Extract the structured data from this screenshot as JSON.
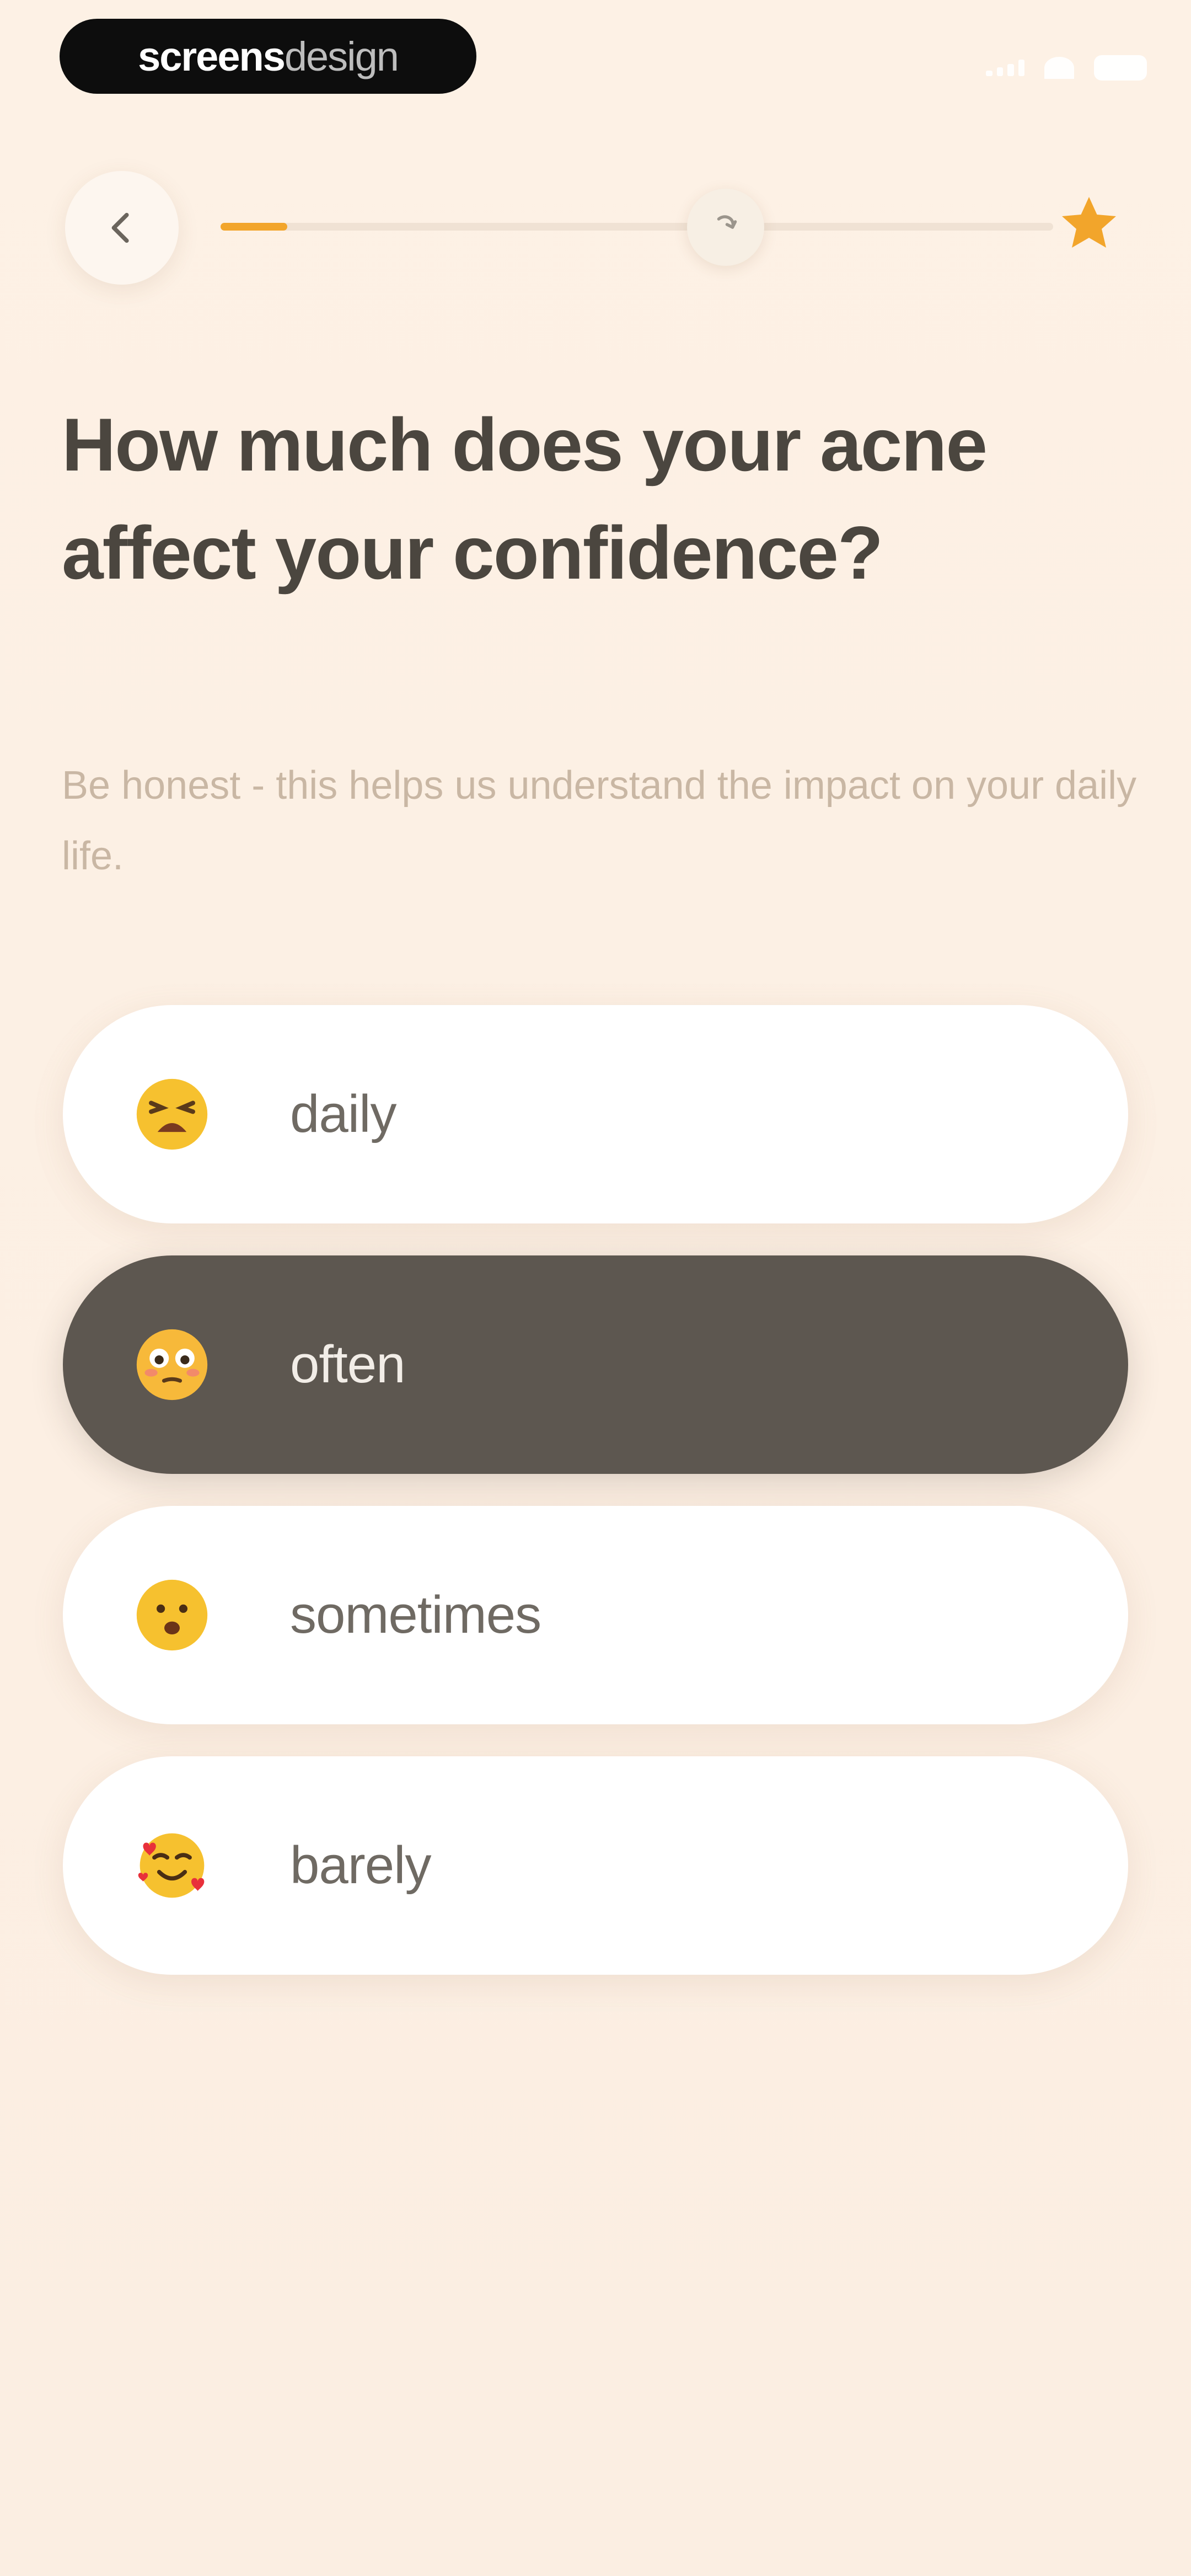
{
  "watermark": {
    "part1": "screens",
    "part2": "design"
  },
  "header": {
    "progress_fraction": 0.08,
    "milestone_icon": "refresh-arrow-icon",
    "goal_icon": "star-icon",
    "accent_color": "#f2a52b"
  },
  "question": {
    "title": "How much does your acne affect your confidence?",
    "hint": "Be honest - this helps us understand the impact on your daily life."
  },
  "options": [
    {
      "label": "daily",
      "icon": "tired-face-emoji",
      "selected": false
    },
    {
      "label": "often",
      "icon": "flushed-face-emoji",
      "selected": true
    },
    {
      "label": "sometimes",
      "icon": "anguished-face-emoji",
      "selected": false
    },
    {
      "label": "barely",
      "icon": "smiling-hearts-face-emoji",
      "selected": false
    }
  ],
  "colors": {
    "background": "#fcefe3",
    "selected_option": "#5d5750",
    "title_text": "#4b463f"
  }
}
